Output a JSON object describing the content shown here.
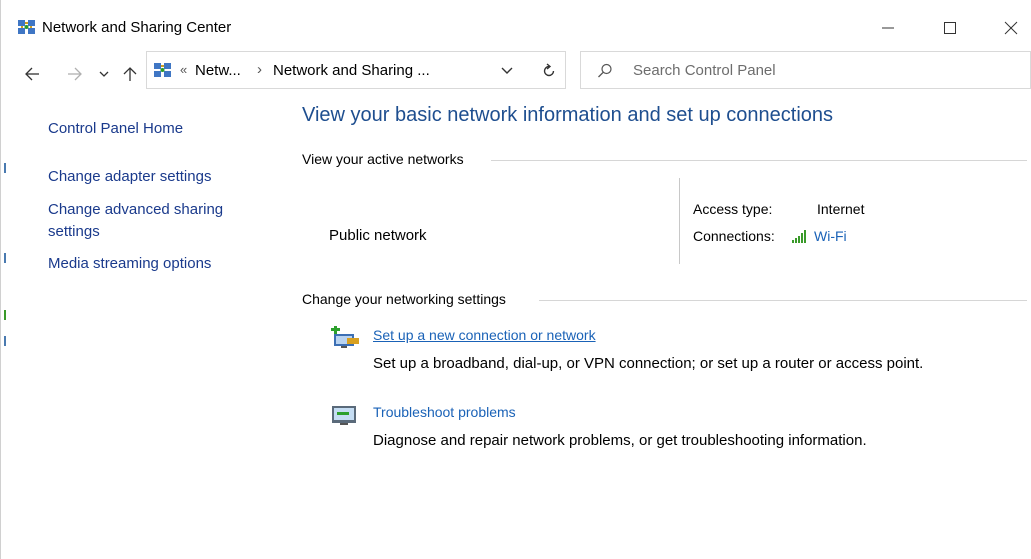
{
  "window": {
    "title": "Network and Sharing Center",
    "app_icon": "network-globe-icon"
  },
  "navigation": {
    "back_icon": "arrow-left-icon",
    "forward_icon": "arrow-right-icon",
    "recent_icon": "chevron-down-icon",
    "up_icon": "arrow-up-icon",
    "address": {
      "separator_root": "«",
      "crumb_1": "Netw...",
      "separator": "›",
      "crumb_2": "Network and Sharing ..."
    },
    "search": {
      "placeholder": "Search Control Panel"
    }
  },
  "sidebar": {
    "items": [
      {
        "label": "Control Panel Home"
      },
      {
        "label": "Change adapter settings"
      },
      {
        "label": "Change advanced sharing settings"
      },
      {
        "label": "Media streaming options"
      }
    ]
  },
  "main": {
    "heading": "View your basic network information and set up connections",
    "active_networks": {
      "title": "View your active networks",
      "network_name": "Public network",
      "access_type_label": "Access type:",
      "access_type_value": "Internet",
      "connections_label": "Connections:",
      "connection_name": "Wi-Fi"
    },
    "change_settings": {
      "title": "Change your networking settings",
      "tasks": [
        {
          "link": "Set up a new connection or network",
          "description": "Set up a broadband, dial-up, or VPN connection; or set up a router or access point."
        },
        {
          "link": "Troubleshoot problems",
          "description": "Diagnose and repair network problems, or get troubleshooting information."
        }
      ]
    }
  },
  "colors": {
    "heading": "#1e4e8f",
    "link": "#1a62b7",
    "sidebar_link": "#1a3a8c",
    "wifi_signal": "#3a9a2a"
  }
}
